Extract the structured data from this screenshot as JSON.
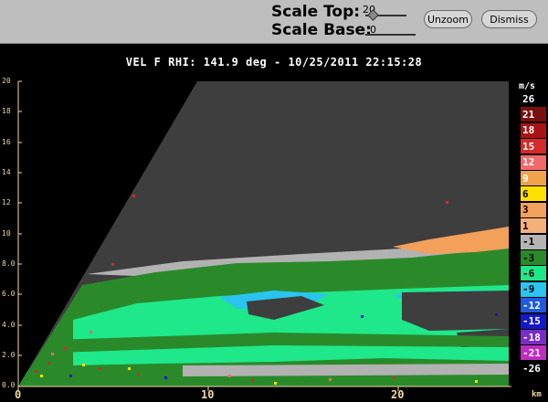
{
  "toolbar": {
    "scale_top_label": "Scale Top:",
    "scale_top_value": "20",
    "scale_base_label": "Scale Base:",
    "scale_base_value": "0",
    "unzoom_label": "Unzoom",
    "dismiss_label": "Dismiss"
  },
  "plot": {
    "title": "VEL F  RHI: 141.9 deg  -  10/25/2011 22:15:28",
    "x_unit": "km",
    "y_ticks": [
      "20",
      "18",
      "16",
      "14",
      "12",
      "10",
      "8.0",
      "6.0",
      "4.0",
      "2.0",
      "0.0"
    ],
    "x_ticks": [
      "0",
      "10",
      "20"
    ]
  },
  "legend": {
    "unit": "m/s",
    "entries": [
      {
        "label": "26",
        "color": "#000000",
        "text_color": "#ffffff"
      },
      {
        "label": "21",
        "color": "#7a0f0f",
        "text_color": "#ffffff"
      },
      {
        "label": "18",
        "color": "#a81414",
        "text_color": "#ffffff"
      },
      {
        "label": "15",
        "color": "#d42a2a",
        "text_color": "#ffffff"
      },
      {
        "label": "12",
        "color": "#f06a6a",
        "text_color": "#ffffff"
      },
      {
        "label": "9",
        "color": "#f0a34a",
        "text_color": "#ffffff"
      },
      {
        "label": "6",
        "color": "#ffe000",
        "text_color": "#000000"
      },
      {
        "label": "3",
        "color": "#f3a05a",
        "text_color": "#000000"
      },
      {
        "label": "1",
        "color": "#f5b07a",
        "text_color": "#000000"
      },
      {
        "label": "-1",
        "color": "#b4b4b4",
        "text_color": "#000000"
      },
      {
        "label": "-3",
        "color": "#2a8a2a",
        "text_color": "#000000"
      },
      {
        "label": "-6",
        "color": "#1ee88a",
        "text_color": "#000000"
      },
      {
        "label": "-9",
        "color": "#29c4f0",
        "text_color": "#000000"
      },
      {
        "label": "-12",
        "color": "#1f5be0",
        "text_color": "#ffffff"
      },
      {
        "label": "-15",
        "color": "#1418c8",
        "text_color": "#ffffff"
      },
      {
        "label": "-18",
        "color": "#7a2cc8",
        "text_color": "#ffffff"
      },
      {
        "label": "-21",
        "color": "#c02cc0",
        "text_color": "#ffffff"
      },
      {
        "label": "-26",
        "color": "#000000",
        "text_color": "#ffffff"
      }
    ]
  }
}
